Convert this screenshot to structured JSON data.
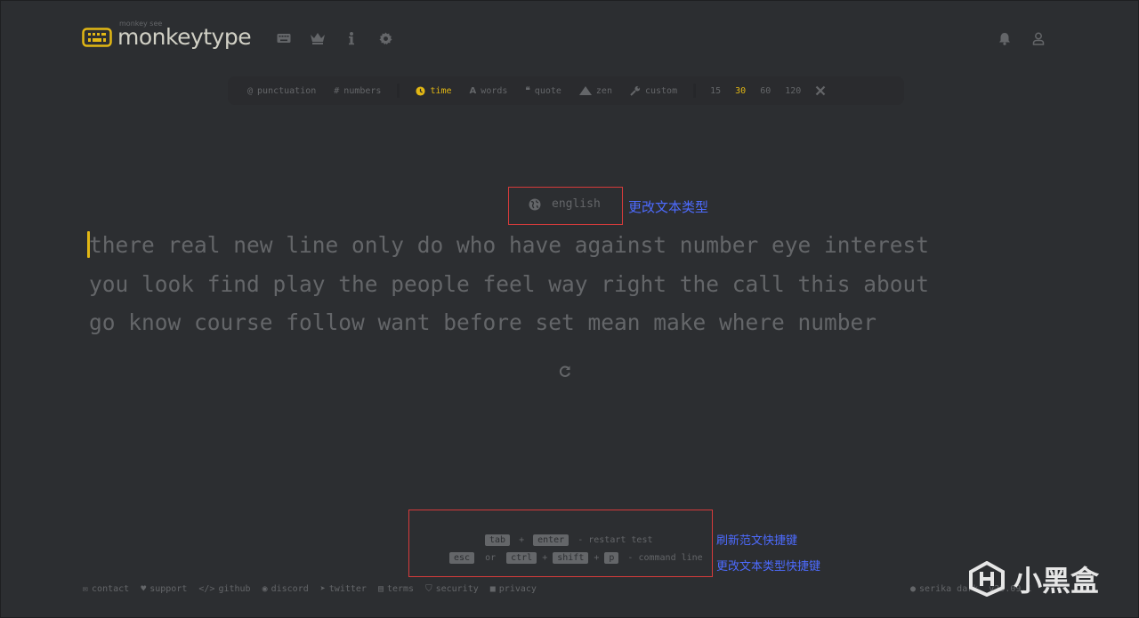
{
  "header": {
    "logo_sub": "monkey see",
    "logo_text": "monkeytype",
    "nav_icons": [
      "keyboard-icon",
      "crown-icon",
      "info-icon",
      "settings-icon"
    ],
    "right_icons": [
      "bell-icon",
      "user-icon"
    ]
  },
  "config": {
    "punctuation": "punctuation",
    "numbers": "numbers",
    "time": "time",
    "words": "words",
    "quote": "quote",
    "zen": "zen",
    "custom": "custom",
    "durations": [
      "15",
      "30",
      "60",
      "120"
    ],
    "selected_duration": "30"
  },
  "language": "english",
  "annotations": {
    "language": "更改文本类型",
    "restart": "刷新范文快捷键",
    "command": "更改文本类型快捷键"
  },
  "words": {
    "line1": "there real new line only do who have against number eye interest",
    "line2": "you look find play the people feel way right the call this about",
    "line3": "go know course follow want before set mean make where number"
  },
  "hints": {
    "tab": "tab",
    "plus": "+",
    "enter": "enter",
    "restart_text": "- restart test",
    "esc": "esc",
    "or": "or",
    "ctrl": "ctrl",
    "shift": "shift",
    "p": "p",
    "command_text": "- command line"
  },
  "footer": {
    "contact": "contact",
    "support": "support",
    "github": "github",
    "discord": "discord",
    "twitter": "twitter",
    "terms": "terms",
    "security": "security",
    "privacy": "privacy",
    "theme": "serika dark",
    "version": "v25.09.1"
  },
  "watermark": "小黑盒",
  "colors": {
    "background": "#2c2e31",
    "main": "#e2b714",
    "sub": "#646669",
    "text": "#d1d0c5",
    "annotation": "#4d6bff",
    "box": "#d63b3b"
  }
}
